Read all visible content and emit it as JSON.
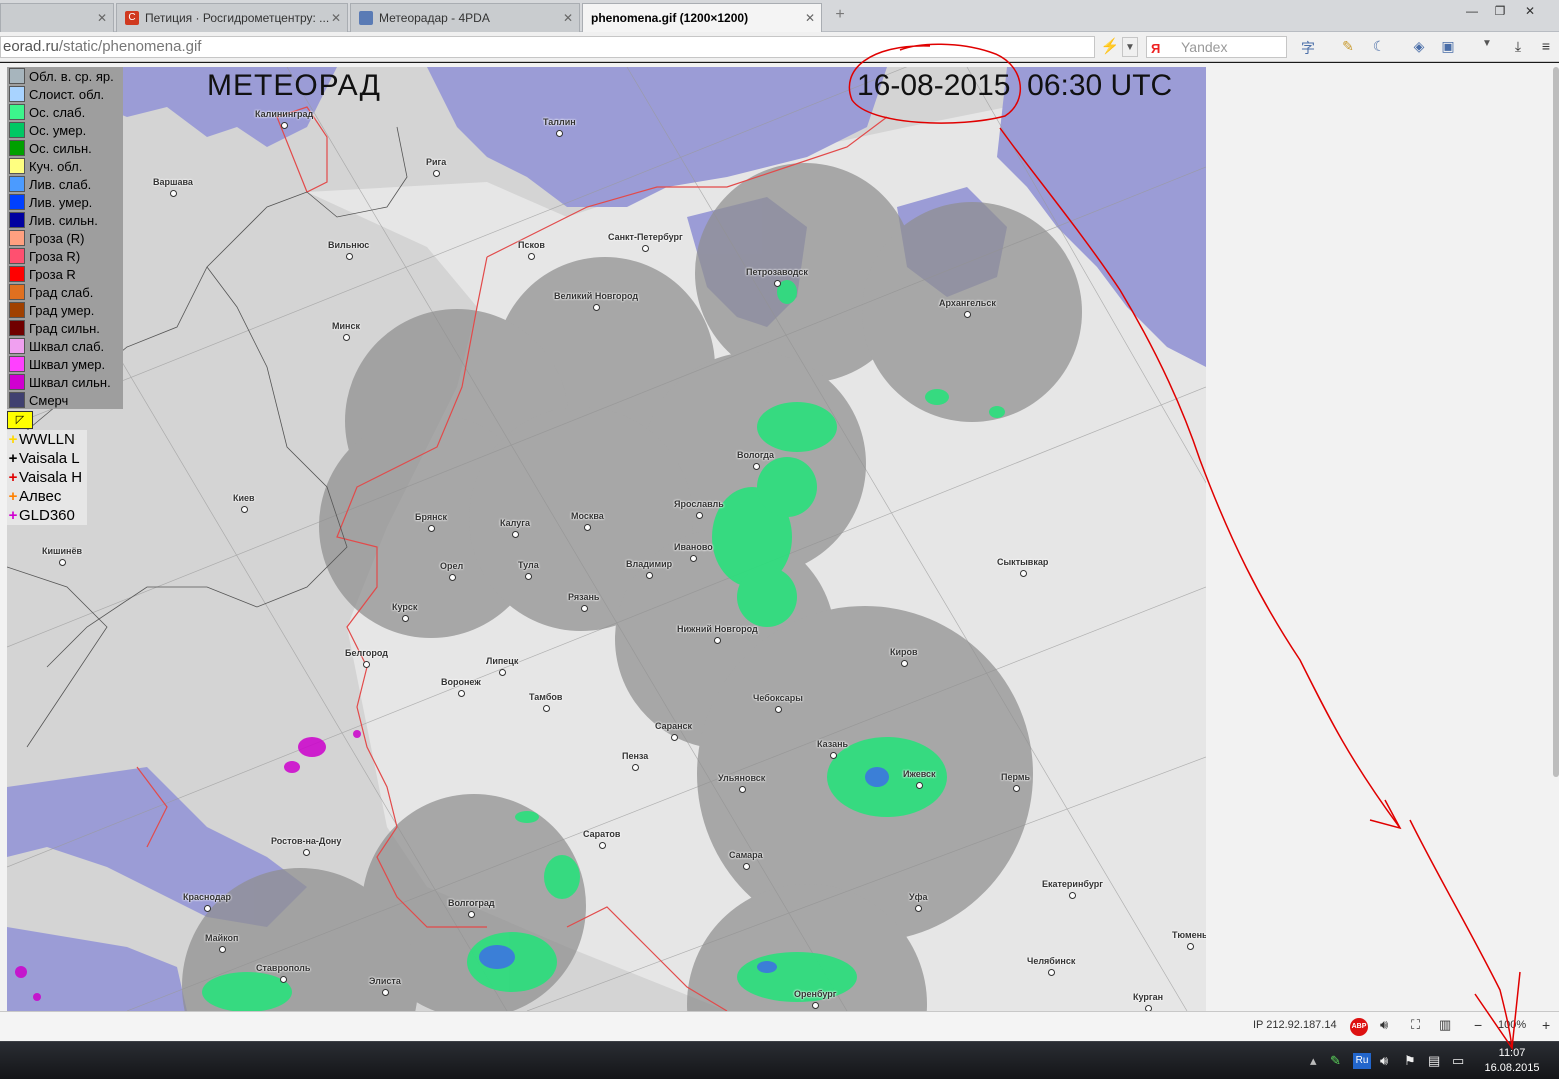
{
  "tabs": [
    {
      "label": "",
      "active": false
    },
    {
      "label": "Петиция · Росгидрометцентру: ...",
      "active": false,
      "favicon_color": "#d0391f"
    },
    {
      "label": "Метеорадар - 4PDA",
      "active": false,
      "favicon_color": "#5a7bb5"
    },
    {
      "label": "phenomena.gif (1200×1200)",
      "active": true
    }
  ],
  "address": {
    "host": "eorad.ru",
    "path": "/static/phenomena.gif"
  },
  "search": {
    "placeholder": "Yandex",
    "logo": "Я"
  },
  "map": {
    "title": "МЕТЕОРАД",
    "date": "16-08-2015",
    "time": "06:30 UTC",
    "colors": {
      "sea": "#9b9cd6",
      "land_out": "#d5d5d5",
      "land_in": "#e6e6e6",
      "radar": "#9a9a9a",
      "border": "#e24a4a"
    },
    "legend": [
      {
        "label": "Обл. в. ср. яр.",
        "color": "#a7b5bd"
      },
      {
        "label": "Слоист. обл.",
        "color": "#a8d3ff"
      },
      {
        "label": "Ос. слаб.",
        "color": "#3cf58c"
      },
      {
        "label": "Ос. умер.",
        "color": "#00c864"
      },
      {
        "label": "Ос. сильн.",
        "color": "#00a000"
      },
      {
        "label": "Куч. обл.",
        "color": "#ffff80"
      },
      {
        "label": "Лив. слаб.",
        "color": "#4b9bff"
      },
      {
        "label": "Лив. умер.",
        "color": "#0040ff"
      },
      {
        "label": "Лив. сильн.",
        "color": "#0000a0"
      },
      {
        "label": "Гроза (R)",
        "color": "#ffa080"
      },
      {
        "label": "Гроза R)",
        "color": "#ff5070"
      },
      {
        "label": "Гроза R",
        "color": "#ff0000"
      },
      {
        "label": "Град слаб.",
        "color": "#e07020"
      },
      {
        "label": "Град умер.",
        "color": "#a04000"
      },
      {
        "label": "Град сильн.",
        "color": "#700000"
      },
      {
        "label": "Шквал слаб.",
        "color": "#f0a0f0"
      },
      {
        "label": "Шквал умер.",
        "color": "#ff40ff"
      },
      {
        "label": "Шквал сильн.",
        "color": "#d000d0"
      },
      {
        "label": "Смерч",
        "color": "#404070"
      }
    ],
    "lightning": [
      {
        "label": "WWLLN",
        "color": "#ffd800"
      },
      {
        "label": "Vaisala L",
        "color": "#000000"
      },
      {
        "label": "Vaisala H",
        "color": "#e00000"
      },
      {
        "label": "Алвес",
        "color": "#ff8000"
      },
      {
        "label": "GLD360",
        "color": "#d000d0"
      }
    ],
    "cities": [
      {
        "name": "Калининград"
      },
      {
        "name": "Таллин"
      },
      {
        "name": "Рига"
      },
      {
        "name": "Варшава"
      },
      {
        "name": "Вильнюс"
      },
      {
        "name": "Псков"
      },
      {
        "name": "Санкт-Петербург"
      },
      {
        "name": "Петрозаводск"
      },
      {
        "name": "Архангельск"
      },
      {
        "name": "Великий Новгород"
      },
      {
        "name": "Минск"
      },
      {
        "name": "Вологда"
      },
      {
        "name": "Ярославль"
      },
      {
        "name": "Киев"
      },
      {
        "name": "Брянск"
      },
      {
        "name": "Калуга"
      },
      {
        "name": "Москва"
      },
      {
        "name": "Иваново"
      },
      {
        "name": "Кишинёв"
      },
      {
        "name": "Орел"
      },
      {
        "name": "Тула"
      },
      {
        "name": "Владимир"
      },
      {
        "name": "Сыктывкар"
      },
      {
        "name": "Курск"
      },
      {
        "name": "Рязань"
      },
      {
        "name": "Нижний Новгород"
      },
      {
        "name": "Белгород"
      },
      {
        "name": "Липецк"
      },
      {
        "name": "Киров"
      },
      {
        "name": "Воронеж"
      },
      {
        "name": "Тамбов"
      },
      {
        "name": "Чебоксары"
      },
      {
        "name": "Саранск"
      },
      {
        "name": "Казань"
      },
      {
        "name": "Пенза"
      },
      {
        "name": "Ижевск"
      },
      {
        "name": "Ульяновск"
      },
      {
        "name": "Пермь"
      },
      {
        "name": "Саратов"
      },
      {
        "name": "Ростов-на-Дону"
      },
      {
        "name": "Самара"
      },
      {
        "name": "Краснодар"
      },
      {
        "name": "Волгоград"
      },
      {
        "name": "Уфа"
      },
      {
        "name": "Екатеринбург"
      },
      {
        "name": "Майкоп"
      },
      {
        "name": "Тюмень"
      },
      {
        "name": "Ставрополь"
      },
      {
        "name": "Челябинск"
      },
      {
        "name": "Элиста"
      },
      {
        "name": "Оренбург"
      },
      {
        "name": "Курган"
      }
    ]
  },
  "statusbar": {
    "ip": "IP 212.92.187.14",
    "abp": "ABP",
    "zoom": "100%",
    "minus": "−",
    "plus": "+"
  },
  "taskbar": {
    "lang": "Ru",
    "time": "11:07",
    "date": "16.08.2015"
  }
}
